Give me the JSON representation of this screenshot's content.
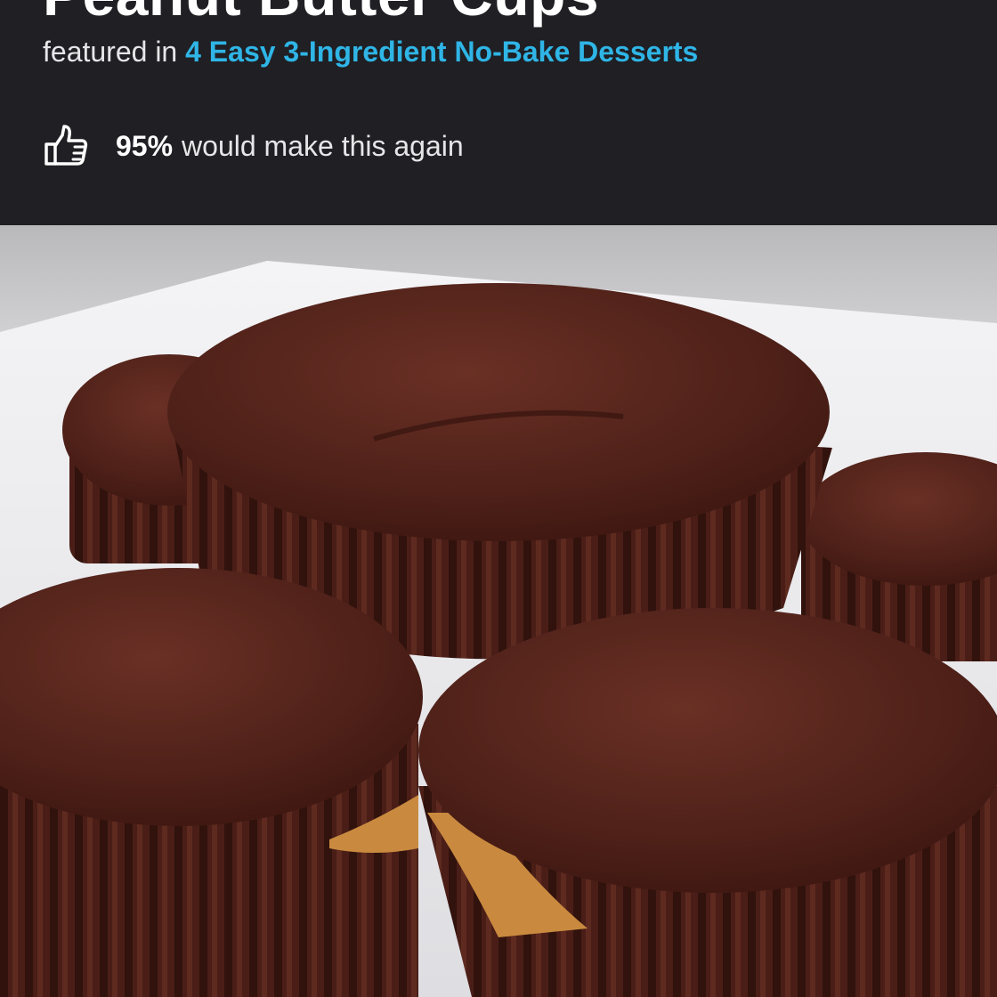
{
  "recipe": {
    "title": "Peanut Butter Cups",
    "featured_prefix": "featured in",
    "featured_link": "4 Easy 3-Ingredient No-Bake Desserts",
    "rating_percent": "95%",
    "rating_text": "would make this again",
    "thumb_icon": "thumbs-up-outline-icon"
  },
  "colors": {
    "header_bg": "#1f1f24",
    "link": "#2fb5e6",
    "text": "#ffffff"
  }
}
